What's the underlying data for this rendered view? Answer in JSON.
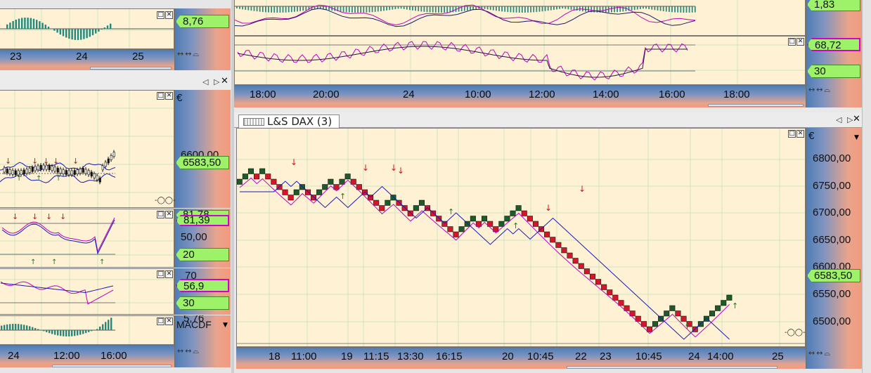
{
  "left_top": {
    "price_tag": "8,76",
    "time_labels": [
      "23",
      "24",
      "25"
    ]
  },
  "left_main": {
    "price_scale_currency": "€",
    "price_scale_label": "6600,00",
    "price_tag": "6583,50",
    "ind1_tag_a": "81,78",
    "ind1_tag_b": "81,39",
    "ind1_label": "50,00",
    "ind1_tag_low": "20",
    "ind2_tag_top": "70",
    "ind2_tag_value": "56,9",
    "ind2_tag_low": "30",
    "macd_label": "5,76",
    "macd_title": "MACDF",
    "time_labels": [
      "24",
      "12:00",
      "16:00"
    ]
  },
  "top_right": {
    "price_tag": "1,83",
    "rsi_tag": "68,72",
    "rsi_low_tag": "30",
    "time_labels": [
      "18:00",
      "20:00",
      "24",
      "10:00",
      "12:00",
      "14:00",
      "16:00",
      "18:00"
    ]
  },
  "main": {
    "tab_title": "L&S DAX (3)",
    "currency": "€",
    "price_labels": [
      "6800,00",
      "6750,00",
      "6700,00",
      "6650,00",
      "6600,00",
      "6550,00",
      "6500,00"
    ],
    "price_tag": "6583,50",
    "time_labels": [
      "18",
      "11:00",
      "19",
      "11:15",
      "13:30",
      "16:15",
      "20",
      "10:45",
      "22",
      "23",
      "10:45",
      "24",
      "14:00",
      "25"
    ]
  },
  "colors": {
    "up_box": "#1f5a2a",
    "down_box": "#d4162b",
    "pane_bg": "#fff2d4",
    "ma_blue": "#1a1ab8",
    "ma_magenta": "#c000c0"
  }
}
